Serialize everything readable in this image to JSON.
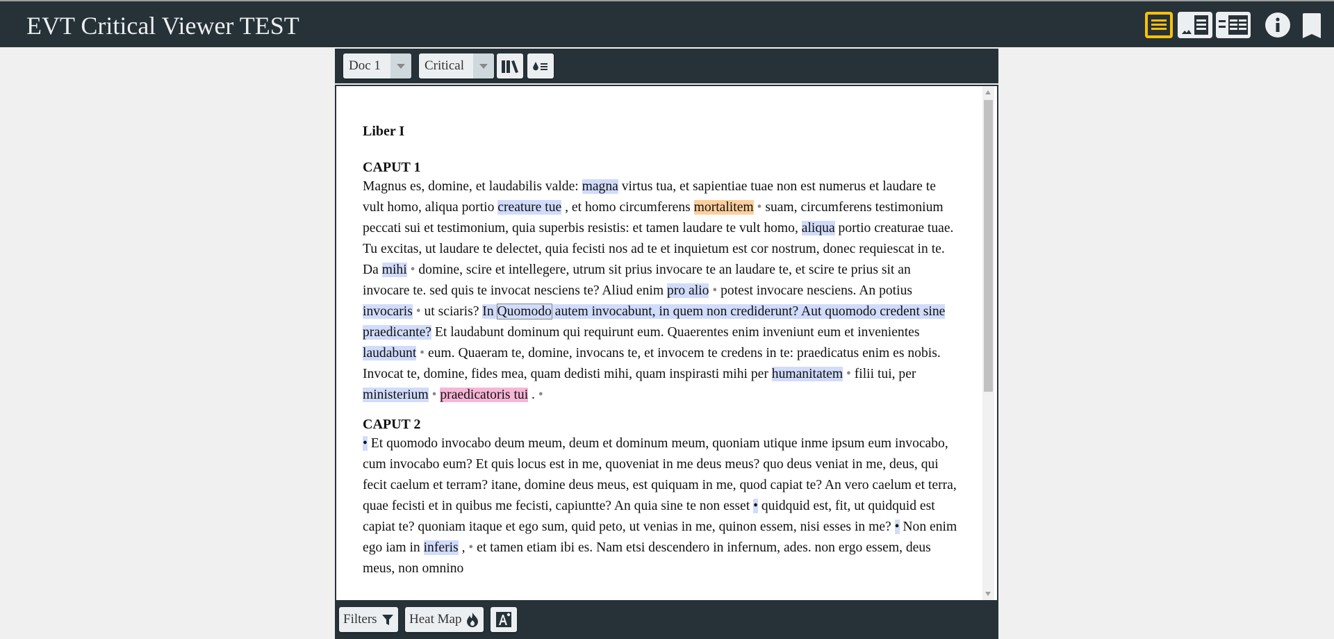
{
  "header": {
    "title": "EVT Critical Viewer TEST",
    "buttons": [
      {
        "name": "text-view",
        "icon": "text-lines-icon",
        "active": true
      },
      {
        "name": "image-text-view",
        "icon": "image-text-icon",
        "active": false
      },
      {
        "name": "text-text-view",
        "icon": "text-text-icon",
        "active": false
      },
      {
        "name": "info",
        "icon": "info-icon",
        "active": false
      },
      {
        "name": "bookmark",
        "icon": "bookmark-icon",
        "active": false
      }
    ],
    "accent": "#ffc107"
  },
  "toolbar": {
    "doc_select": "Doc 1",
    "edition_select": "Critical",
    "witnesses_icon": "books-icon",
    "apparatus_icon": "drop-list-icon"
  },
  "document": {
    "book_title": "Liber I",
    "chapters": [
      {
        "title": "CAPUT 1",
        "segments": [
          {
            "t": "Magnus es, domine, et laudabilis valde: "
          },
          {
            "t": "magna",
            "hl": "blue"
          },
          {
            "t": " virtus tua, et sapientiae tuae non est numerus et laudare te vult homo, aliqua portio "
          },
          {
            "t": "creature tue",
            "hl": "blue"
          },
          {
            "t": " , et homo circumferens "
          },
          {
            "t": "mortalitem",
            "hl": "orange"
          },
          {
            "t": " • ",
            "dot": true
          },
          {
            "t": "suam, circumferens testimonium peccati sui et testimonium, quia superbis resistis: et tamen laudare te vult homo, "
          },
          {
            "t": "aliqua",
            "hl": "blue"
          },
          {
            "t": " portio creaturae tuae. Tu excitas, ut laudare te delectet, quia fecisti nos ad te et inquietum est cor nostrum, donec requiescat in te. Da "
          },
          {
            "t": "mihi",
            "hl": "blue"
          },
          {
            "t": " • ",
            "dot": true
          },
          {
            "t": "domine, scire et intellegere, utrum sit prius invocare te an laudare te, et scire te prius sit an invocare te. sed quis te invocat nesciens te? Aliud enim "
          },
          {
            "t": "pro alio",
            "hl": "blue"
          },
          {
            "t": " • ",
            "dot": true
          },
          {
            "t": "potest invocare nesciens. An potius "
          },
          {
            "t": "invocaris",
            "hl": "blue"
          },
          {
            "t": " • ",
            "dot": true
          },
          {
            "t": "ut sciaris? "
          },
          {
            "t": "In ",
            "hl": "blue"
          },
          {
            "t": "Quomodo",
            "hl": "blue",
            "boxed": true
          },
          {
            "t": " autem invocabunt, in quem non crediderunt? Aut quomodo credent sine praedicante?",
            "hl": "blue"
          },
          {
            "t": " Et laudabunt dominum qui requirunt eum. Quaerentes enim inveniunt eum et invenientes "
          },
          {
            "t": "laudabunt",
            "hl": "blue"
          },
          {
            "t": " • ",
            "dot": true
          },
          {
            "t": "eum. Quaeram te, domine, invocans te, et invocem te credens in te: praedicatus enim es nobis. Invocat te, domine, fides mea, quam dedisti mihi, quam inspirasti mihi per "
          },
          {
            "t": "humanitatem",
            "hl": "blue"
          },
          {
            "t": " • ",
            "dot": true
          },
          {
            "t": "filii tui, per "
          },
          {
            "t": "ministerium",
            "hl": "blue"
          },
          {
            "t": " • ",
            "dot": true
          },
          {
            "t": "praedicatoris tui",
            "hl": "pink"
          },
          {
            "t": " . "
          },
          {
            "t": "•",
            "dot": true
          }
        ]
      },
      {
        "title": "CAPUT 2",
        "segments": [
          {
            "t": "•",
            "hl": "blue"
          },
          {
            "t": " Et quomodo invocabo deum meum, deum et dominum meum, quoniam utique inme ipsum eum invocabo, cum invocabo eum? Et quis locus est in me, quoveniat in me deus meus? quo deus veniat in me, deus, qui fecit caelum et terram? itane, domine deus meus, est quiquam in me, quod capiat te? An vero caelum et terra, quae fecisti et in quibus me fecisti, capiuntte? An quia sine te non esset "
          },
          {
            "t": "•",
            "hl": "blue"
          },
          {
            "t": " quidquid est, fit, ut quidquid est capiat te? quoniam itaque et ego sum, quid peto, ut venias in me, quinon essem, nisi esses in me? "
          },
          {
            "t": "•",
            "hl": "blue"
          },
          {
            "t": " Non enim ego iam in "
          },
          {
            "t": "inferis",
            "hl": "blue"
          },
          {
            "t": " , "
          },
          {
            "t": "• ",
            "dot": true
          },
          {
            "t": "et tamen etiam ibi es. Nam etsi descendero in infernum, ades. non ergo essem, deus meus, non omnino"
          }
        ]
      }
    ],
    "highlight_colors": {
      "blue": "#d1dcfb",
      "orange": "#fdcf9e",
      "pink": "#f7b6d6"
    }
  },
  "bottombar": {
    "filters_label": "Filters",
    "filters_icon": "filter-icon",
    "heatmap_label": "Heat Map",
    "heatmap_icon": "fire-icon",
    "font_size_icon": "font-size-icon"
  }
}
